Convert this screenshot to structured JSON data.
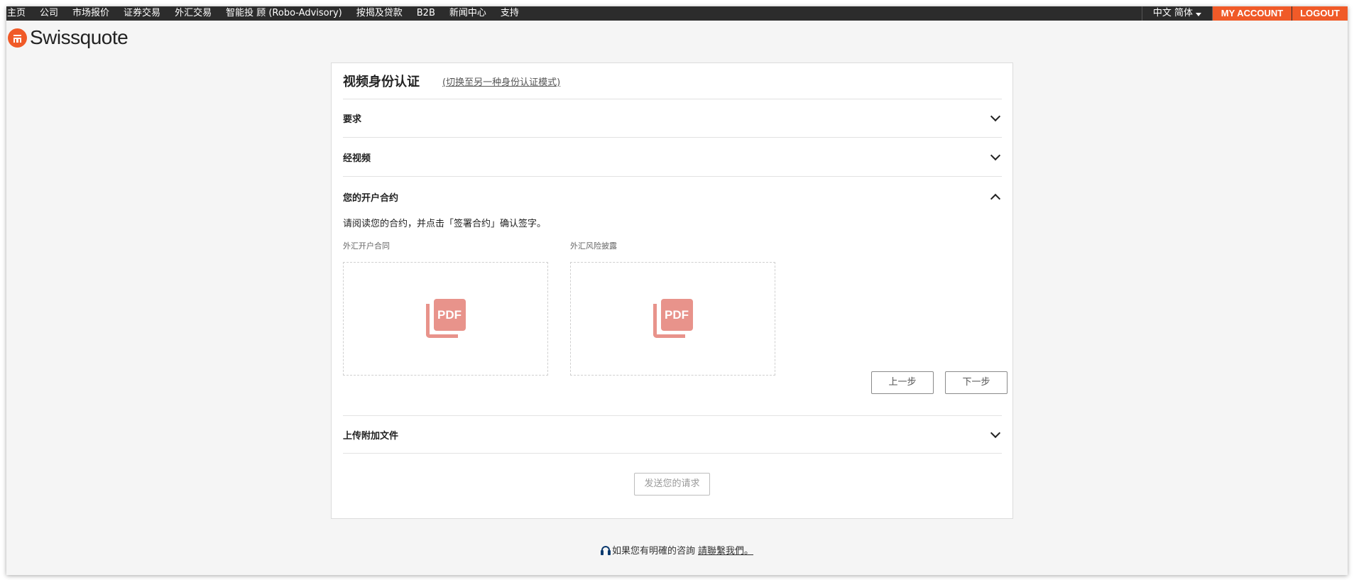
{
  "nav": {
    "items": [
      "主页",
      "公司",
      "市场报价",
      "证券交易",
      "外汇交易",
      "智能投 顾 (Robo-Advisory)",
      "按揭及贷款",
      "B2B",
      "新闻中心",
      "支持"
    ],
    "language": "中文 简体",
    "my_account": "MY ACCOUNT",
    "logout": "LOGOUT"
  },
  "logo": {
    "text": "Swissquote"
  },
  "card": {
    "title": "视频身份认证",
    "switch_link": "(切换至另一种身份认证模式)",
    "sections": {
      "requirements": "要求",
      "via_video": "经视频",
      "contract": "您的开户合约",
      "upload": "上传附加文件"
    },
    "instruction": "请阅读您的合约，并点击「签署合约」确认签字。",
    "documents": [
      {
        "label": "外汇开户合同",
        "icon_text": "PDF"
      },
      {
        "label": "外汇风险披露",
        "icon_text": "PDF"
      }
    ],
    "prev_button": "上一步",
    "next_button": "下一步",
    "send_button": "发送您的请求"
  },
  "footer": {
    "text": "如果您有明確的咨詢",
    "link": "請聯繫我們。"
  },
  "colors": {
    "brand": "#f05a28",
    "nav_bg": "#2c2c2c",
    "pdf_icon": "#e8938b"
  }
}
